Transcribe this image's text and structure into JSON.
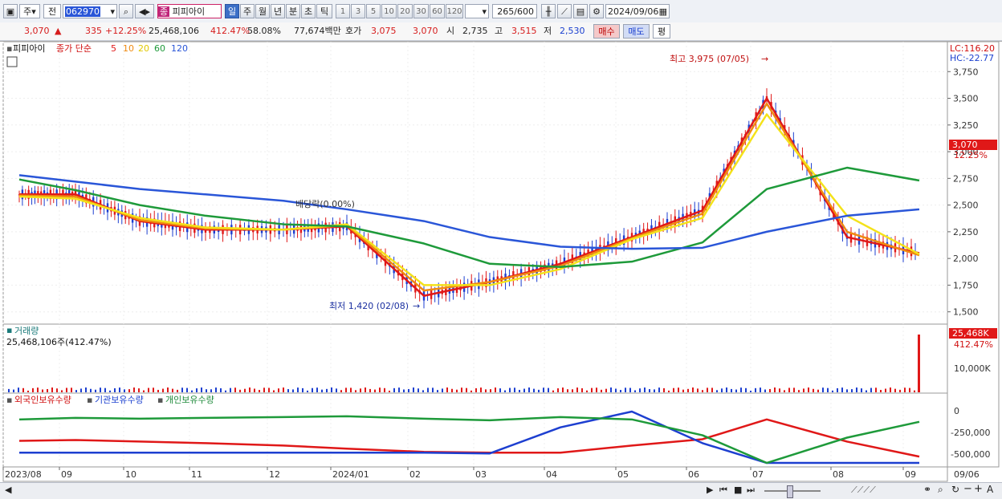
{
  "toolbar": {
    "mode1": "주",
    "mode2": "전",
    "code": "062970",
    "stock_badge": "종",
    "stock_name": "피피아이",
    "periods": [
      "일",
      "주",
      "월",
      "년",
      "분",
      "초",
      "틱"
    ],
    "selected_period": "일",
    "counts": [
      "1",
      "3",
      "5",
      "10",
      "20",
      "30",
      "60",
      "120"
    ],
    "range_value": "265",
    "range_total": "/600",
    "date": "2024/09/06"
  },
  "quote": {
    "price": "3,070",
    "arrow": "▲",
    "change": "335",
    "change_pct": "+12.25%",
    "volume": "25,468,106",
    "volume_pct": "412.47%",
    "turnover": "58.08%",
    "amount": "77,674백만",
    "hoga_label": "호가",
    "hoga1": "3,075",
    "hoga2": "3,070",
    "open_label": "시",
    "open": "2,735",
    "high_label": "고",
    "high": "3,515",
    "low_label": "저",
    "low": "2,530",
    "buy_label": "매수",
    "sell_label": "매도",
    "eval_label": "평"
  },
  "price_panel": {
    "legend_name": "피피아이",
    "legend_series": "종가 단순",
    "ma_labels": [
      "5",
      "10",
      "20",
      "60",
      "120"
    ],
    "lc": "LC:116.20",
    "hc": "HC:-22.77",
    "high_note": "최고 3,975 (07/05)",
    "low_note": "최저 1,420 (02/08)",
    "dividend_note": "배당락(0.00%)",
    "last_price": "3,070",
    "last_pct": "12.25%",
    "y_ticks": [
      "3,750",
      "3,500",
      "3,250",
      "3,000",
      "2,750",
      "2,500",
      "2,250",
      "2,000",
      "1,750",
      "1,500"
    ]
  },
  "volume_panel": {
    "title": "거래량",
    "subtitle": "25,468,106주(412.47%)",
    "last_value": "25,468K",
    "last_pct": "412.47%",
    "y_tick": "10,000K"
  },
  "holding_panel": {
    "legend": [
      "외국인보유수량",
      "기관보유수량",
      "개인보유수량"
    ],
    "y_ticks": [
      "0",
      "-250,000",
      "-500,000"
    ]
  },
  "x_axis": {
    "labels": [
      "2023/08",
      "09",
      "10",
      "11",
      "12",
      "2024/01",
      "02",
      "03",
      "04",
      "05",
      "06",
      "07",
      "08",
      "09"
    ],
    "right_label": "09/06"
  },
  "colors": {
    "ma5": "#e01818",
    "ma10": "#f08a10",
    "ma20": "#f4e21a",
    "ma60": "#1e9a3a",
    "ma120": "#2a56d8",
    "up": "#e01818",
    "down": "#1d3fd0"
  },
  "chart_data": {
    "type": "line",
    "title": "",
    "x": [
      "2023/08",
      "09",
      "10",
      "11",
      "12",
      "2024/01",
      "02",
      "03",
      "04",
      "05",
      "06",
      "07",
      "08",
      "09"
    ],
    "series": [
      {
        "name": "5",
        "values": [
          2600,
          2600,
          2350,
          2270,
          2270,
          2300,
          1650,
          1780,
          1950,
          2200,
          2450,
          3500,
          2200,
          2050
        ]
      },
      {
        "name": "10",
        "values": [
          2590,
          2580,
          2360,
          2280,
          2270,
          2310,
          1700,
          1780,
          1930,
          2190,
          2420,
          3450,
          2250,
          2030
        ]
      },
      {
        "name": "20",
        "values": [
          2580,
          2560,
          2380,
          2290,
          2270,
          2320,
          1750,
          1750,
          1900,
          2180,
          2380,
          3350,
          2400,
          2040
        ]
      },
      {
        "name": "60",
        "values": [
          2740,
          2640,
          2500,
          2400,
          2320,
          2300,
          2140,
          1950,
          1920,
          1970,
          2150,
          2650,
          2850,
          2730
        ]
      },
      {
        "name": "120",
        "values": [
          2780,
          2720,
          2650,
          2600,
          2540,
          2460,
          2350,
          2200,
          2110,
          2090,
          2100,
          2250,
          2400,
          2460
        ]
      }
    ],
    "holding_series": [
      {
        "name": "외국인보유수량",
        "values": [
          -320000,
          -310000,
          -330000,
          -350000,
          -380000,
          -420000,
          -460000,
          -470000,
          -470000,
          -380000,
          -300000,
          -50000,
          -330000,
          -520000
        ]
      },
      {
        "name": "기관보유수량",
        "values": [
          -470000,
          -470000,
          -470000,
          -470000,
          -470000,
          -470000,
          -470000,
          -480000,
          -150000,
          50000,
          -350000,
          -600000,
          -600000,
          -600000
        ]
      },
      {
        "name": "개인보유수량",
        "values": [
          -50000,
          -30000,
          -40000,
          -30000,
          -20000,
          -10000,
          -40000,
          -60000,
          -20000,
          -50000,
          -250000,
          -600000,
          -280000,
          -80000
        ]
      }
    ],
    "ylim": [
      1400,
      4000
    ],
    "ylabel": "",
    "xlabel": ""
  }
}
